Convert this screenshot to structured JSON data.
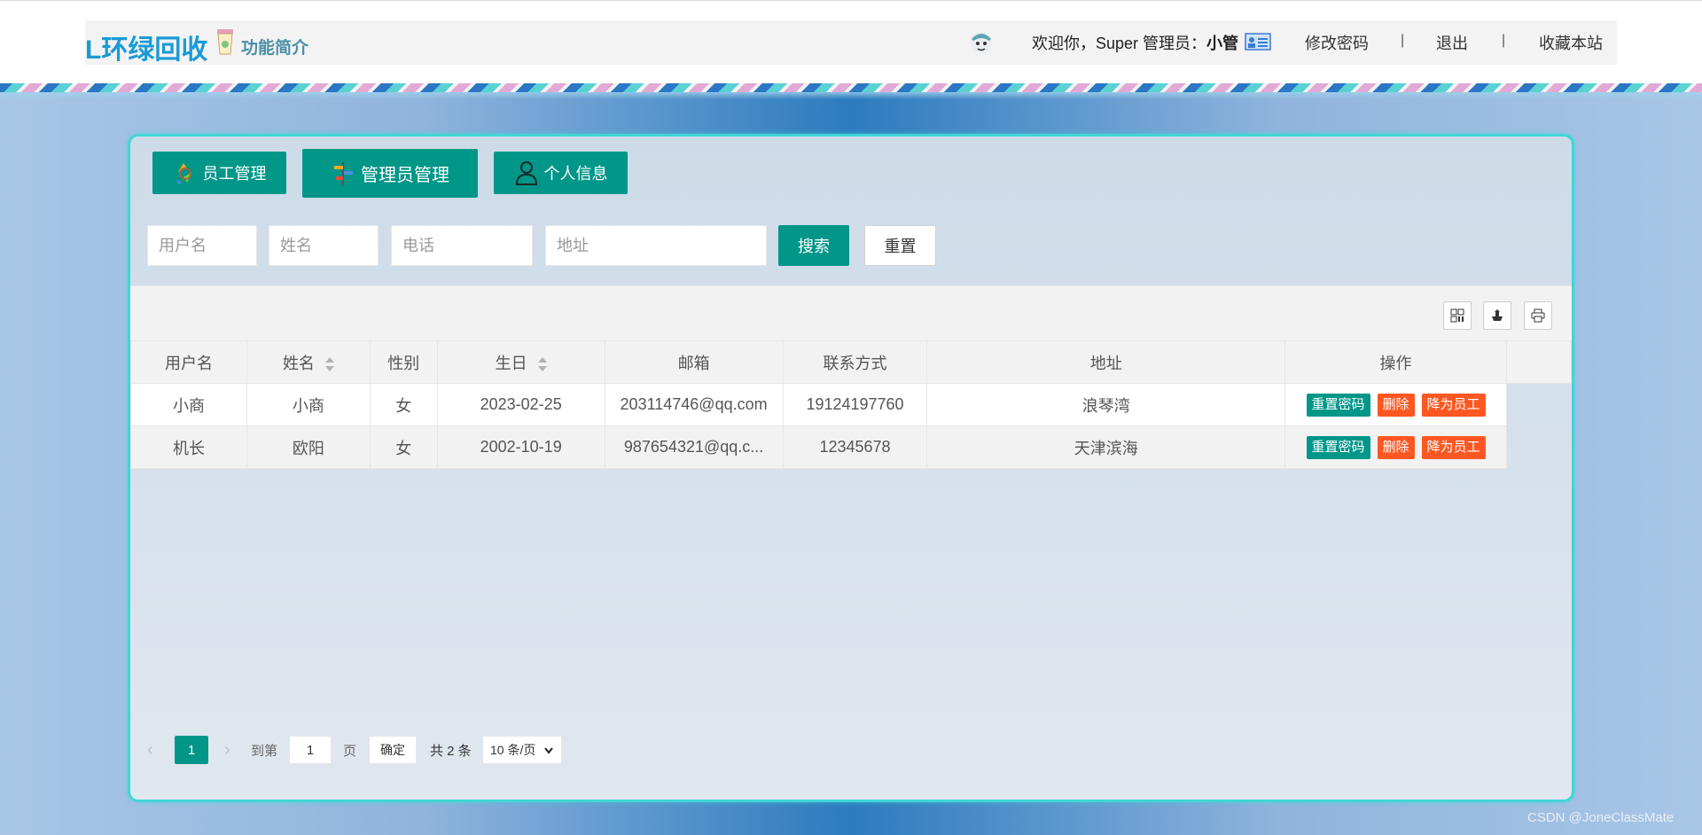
{
  "header": {
    "logo": "L环绿回收",
    "intro": "功能简介",
    "welcome_prefix": "欢迎你，Super 管理员：",
    "user_name": "小管",
    "links": [
      "修改密码",
      "退出",
      "收藏本站"
    ],
    "separator": "|"
  },
  "tabs": [
    "员工管理",
    "管理员管理",
    "个人信息"
  ],
  "search": {
    "username_placeholder": "用户名",
    "name_placeholder": "姓名",
    "phone_placeholder": "电话",
    "address_placeholder": "地址",
    "search_label": "搜索",
    "reset_label": "重置"
  },
  "table": {
    "headers": [
      "用户名",
      "姓名",
      "性别",
      "生日",
      "邮箱",
      "联系方式",
      "地址",
      "操作"
    ],
    "rows": [
      {
        "username": "小商",
        "name": "小商",
        "gender": "女",
        "birthday": "2023-02-25",
        "email": "203114746@qq.com",
        "phone": "19124197760",
        "address": "浪琴湾"
      },
      {
        "username": "机长",
        "name": "欧阳",
        "gender": "女",
        "birthday": "2002-10-19",
        "email": "987654321@qq.c...",
        "phone": "12345678",
        "address": "天津滨海"
      }
    ],
    "actions": [
      "重置密码",
      "删除",
      "降为员工"
    ]
  },
  "pager": {
    "prev": "‹",
    "current": "1",
    "next": "›",
    "goto_label": "到第",
    "goto_value": "1",
    "page_unit": "页",
    "confirm": "确定",
    "total": "共 2 条",
    "page_size": "10 条/页"
  },
  "watermark": "CSDN @JoneClassMate",
  "colors": {
    "primary": "#009688",
    "danger": "#ff5722",
    "logo": "#1a9ad6",
    "panel_border": "#3fd6d6"
  },
  "icons": [
    "cup-icon",
    "avatar",
    "id-card-icon",
    "recycle-icon",
    "signpost-icon",
    "person-icon",
    "columns-icon",
    "export-icon",
    "print-icon",
    "sort-icon"
  ]
}
